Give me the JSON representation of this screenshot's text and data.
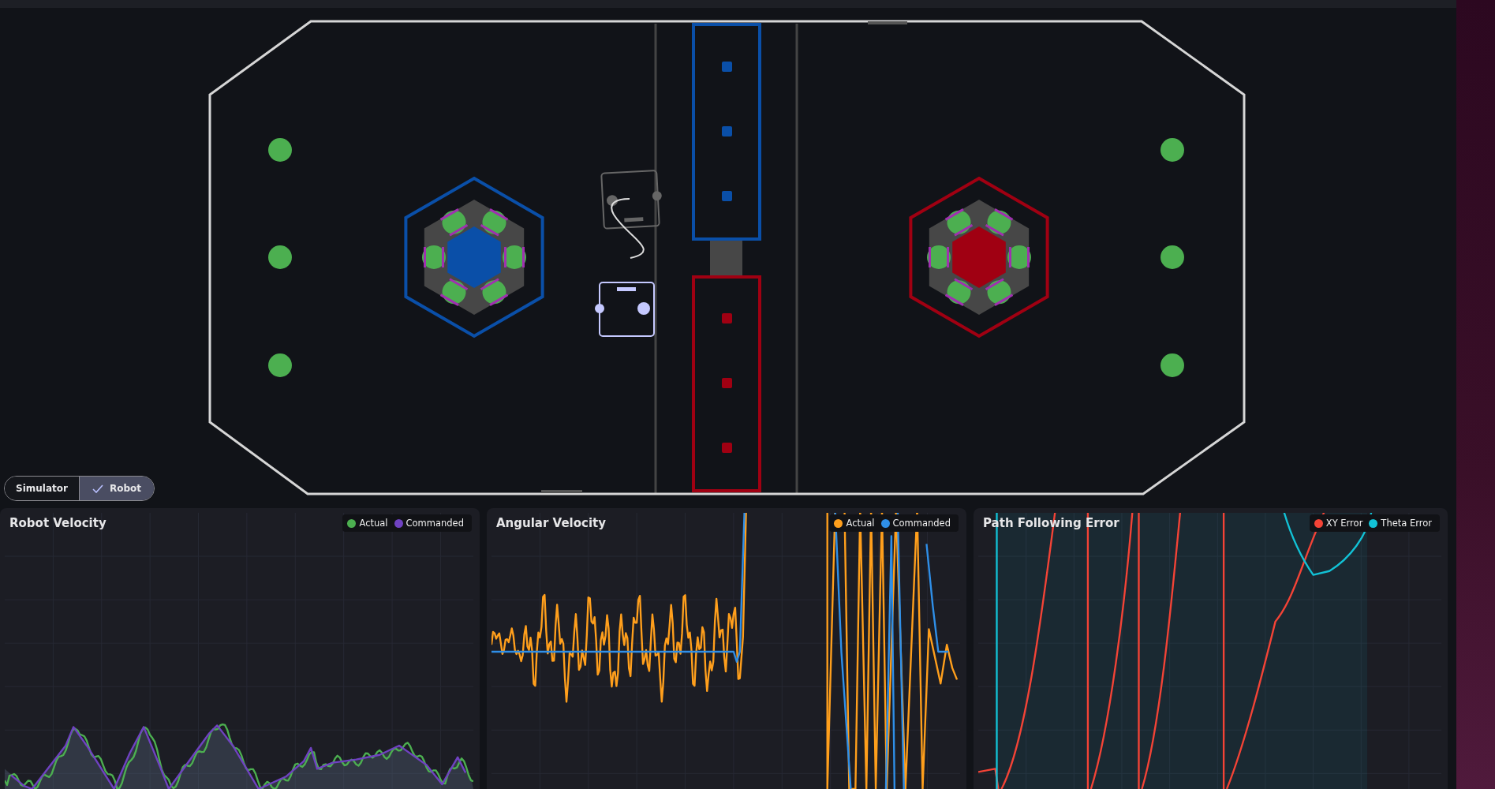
{
  "mode_toggle": [
    {
      "label": "Simulator",
      "selected": false
    },
    {
      "label": "Robot",
      "selected": true
    }
  ],
  "charts": [
    {
      "title": "Robot Velocity",
      "legend": [
        {
          "label": "Actual",
          "color": "#4caf50"
        },
        {
          "label": "Commanded",
          "color": "#6f42c1"
        }
      ]
    },
    {
      "title": "Angular Velocity",
      "legend": [
        {
          "label": "Actual",
          "color": "#ff9f1c"
        },
        {
          "label": "Commanded",
          "color": "#2f8fe8"
        }
      ]
    },
    {
      "title": "Path Following Error",
      "legend": [
        {
          "label": "XY Error",
          "color": "#f44336"
        },
        {
          "label": "Theta Error",
          "color": "#12c2d6"
        }
      ]
    }
  ]
}
